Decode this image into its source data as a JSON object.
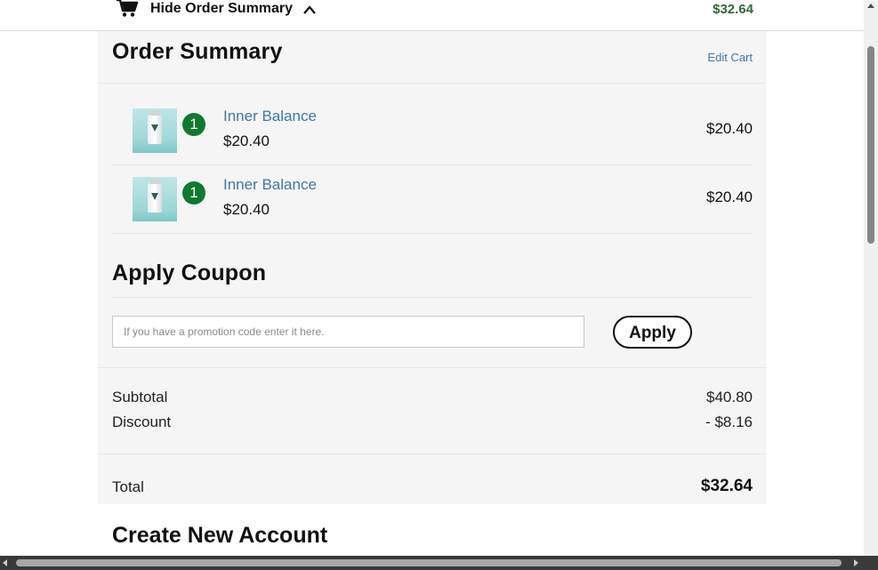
{
  "header": {
    "toggle_label": "Hide Order Summary",
    "total": "$32.64",
    "cart_icon": "shopping-cart-icon",
    "chevron_icon": "chevron-up-icon",
    "total_color": "#2d6a35"
  },
  "summary": {
    "title": "Order Summary",
    "edit_cart": "Edit Cart",
    "items": [
      {
        "qty": "1",
        "name": "Inner Balance",
        "price": "$20.40",
        "line_total": "$20.40"
      },
      {
        "qty": "1",
        "name": "Inner Balance",
        "price": "$20.40",
        "line_total": "$20.40"
      }
    ]
  },
  "coupon": {
    "title": "Apply Coupon",
    "placeholder": "If you have a promotion code enter it here.",
    "value": "",
    "apply_label": "Apply"
  },
  "totals": {
    "subtotal_label": "Subtotal",
    "subtotal_value": "$40.80",
    "discount_label": "Discount",
    "discount_value": "- $8.16",
    "total_label": "Total",
    "total_value": "$32.64"
  },
  "account": {
    "title": "Create New Account"
  },
  "colors": {
    "accent_link": "#3f78a8",
    "qty_badge": "#0f7a2f",
    "panel_bg": "#f5f5f5"
  }
}
